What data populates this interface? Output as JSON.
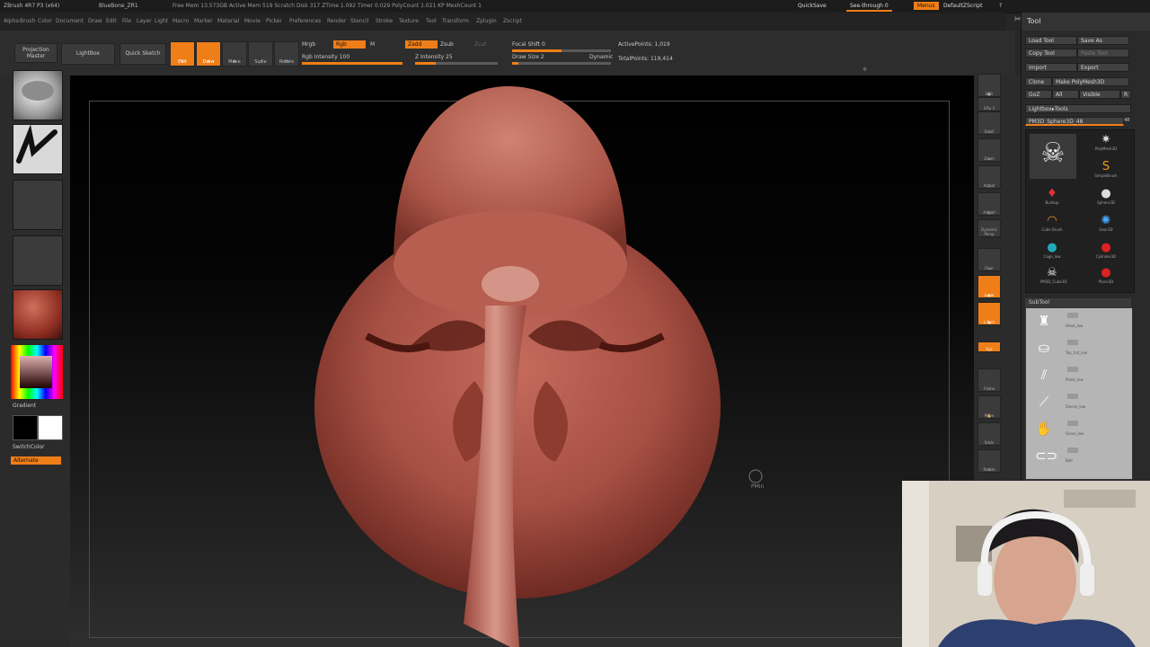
{
  "menubar": {
    "title": "ZBrush 4R7 P3 (x64)",
    "doc": "BlueBone_ZR1",
    "stats": "Free Mem 13.573GB  Active Mem 519  Scratch Disk 317  ZTime 1.092  Timer 0.029  PolyCount 1.021 KP  MeshCount 1",
    "quicksave": "QuickSave",
    "see_through": "See-through  0",
    "menus_btn": "Menus",
    "script": "DefaultZScript",
    "menu_items": [
      "Alpha",
      "Brush",
      "Color",
      "Document",
      "Draw",
      "Edit",
      "File",
      "Layer",
      "Light",
      "Macro",
      "Marker",
      "Material",
      "Movie",
      "Picker",
      "Preferences",
      "Render",
      "Stencil",
      "Stroke",
      "Texture",
      "Tool",
      "Transform",
      "Zplugin",
      "Zscript"
    ]
  },
  "toolbar": {
    "projection_master": "Projection Master",
    "lightbox": "LightBox",
    "quick_sketch": "Quick Sketch",
    "edit": "Edit",
    "draw": "Draw",
    "move": "Move",
    "scale": "Scale",
    "rotate": "Rotate",
    "mrgb": "Mrgb",
    "rgb": "Rgb",
    "m": "M",
    "rgb_intensity": "Rgb Intensity 100",
    "zadd": "Zadd",
    "zsub": "Zsub",
    "zcut": "Zcut",
    "z_intensity": "Z Intensity 25",
    "focal_shift": "Focal Shift 0",
    "draw_size": "Draw Size 2",
    "dynamic": "Dynamic",
    "active_points": "ActivePoints: 1,019",
    "total_points": "TotalPoints: 119,414"
  },
  "leftshelf": {
    "gradient": "Gradient",
    "switch_color": "SwitchColor",
    "alternate": "Alternate"
  },
  "rightshelf": {
    "buttons": [
      "BPR",
      "SPix 3",
      "Scroll",
      "Zoom",
      "Actual",
      "AAHalf",
      "Dynamic Persp",
      "Floor",
      "Local",
      "L.Sym",
      "Xyz",
      "Frame",
      "Move",
      "Scale",
      "Rotate",
      "Line Fill PolyF",
      "Transp",
      "Solo",
      "Xpose"
    ]
  },
  "tool_panel": {
    "title": "Tool",
    "load_tool": "Load Tool",
    "save_as": "Save As",
    "copy_tool": "Copy Tool",
    "paste_tool": "Paste Tool",
    "import": "Import",
    "export": "Export",
    "clone": "Clone",
    "make_polymesh": "Make PolyMesh3D",
    "goz": "GoZ",
    "all": "All",
    "visible": "Visible",
    "r": "R",
    "lightbox_tools": "Lightbox▸Tools",
    "current_tool": "PM3D_Sphere3D_48",
    "count": "48",
    "thumbs": [
      "PM3D_Sphere3D",
      "PolyMesh3D",
      "SimpleBrush",
      "ZSphere",
      "Buildup",
      "Sphere3D",
      "Cube Brush",
      "Gear3D",
      "Cage_low",
      "Cylinder3D",
      "PM3D_Cube3D",
      "Plane3D"
    ],
    "subtool_title": "SubTool",
    "subtools": [
      "Head_low",
      "Top_hat_low",
      "Pants_low",
      "Sleeve_low",
      "Glove_low",
      "Belt"
    ]
  },
  "viewport": {
    "cursor_label": "PMin"
  },
  "colors": {
    "accent": "#f07e18",
    "clay": "#a64f43",
    "panel": "#2b2b2b"
  }
}
